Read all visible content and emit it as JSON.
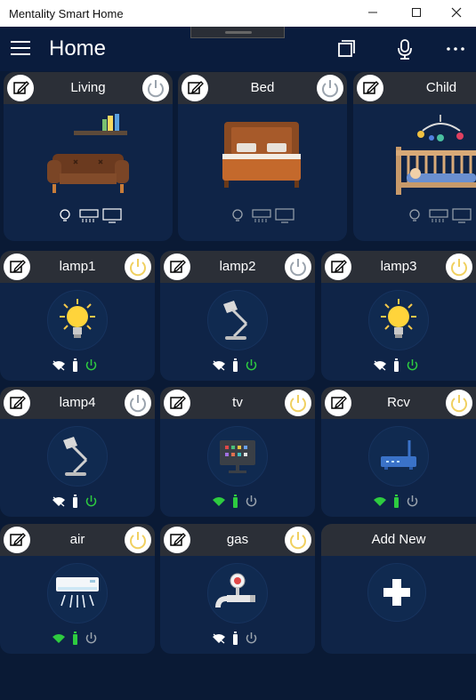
{
  "window": {
    "title": "Mentality Smart Home",
    "minimize": "—",
    "maximize": "☐",
    "close": "✕"
  },
  "appbar": {
    "title": "Home"
  },
  "rooms": [
    {
      "name": "Living"
    },
    {
      "name": "Bed"
    },
    {
      "name": "Child"
    }
  ],
  "devices": [
    {
      "name": "lamp1",
      "icon": "bulb-on-icon",
      "power": "on",
      "wifi": false,
      "remote": false,
      "power_status": true
    },
    {
      "name": "lamp2",
      "icon": "desk-lamp-icon",
      "power": "off",
      "wifi": false,
      "remote": false,
      "power_status": true
    },
    {
      "name": "lamp3",
      "icon": "bulb-on-icon",
      "power": "on",
      "wifi": false,
      "remote": false,
      "power_status": true
    },
    {
      "name": "lamp4",
      "icon": "desk-lamp-icon",
      "power": "off",
      "wifi": false,
      "remote": false,
      "power_status": true
    },
    {
      "name": "tv",
      "icon": "tv-icon",
      "power": "on",
      "wifi": true,
      "remote": true,
      "power_status": false
    },
    {
      "name": "Rcv",
      "icon": "router-icon",
      "power": "on",
      "wifi": true,
      "remote": true,
      "power_status": false
    },
    {
      "name": "air",
      "icon": "air-conditioner-icon",
      "power": "on",
      "wifi": true,
      "remote": true,
      "power_status": false
    },
    {
      "name": "gas",
      "icon": "gas-valve-icon",
      "power": "on",
      "wifi": false,
      "remote": false,
      "power_status": false
    }
  ],
  "add_new": {
    "label": "Add New"
  },
  "colors": {
    "background": "#0a1a35",
    "card": "#0f2447",
    "header": "#2b2f37",
    "active_green": "#2ecc40",
    "power_on_yellow": "#f0d060",
    "inactive_grey": "#9aa3ad"
  }
}
